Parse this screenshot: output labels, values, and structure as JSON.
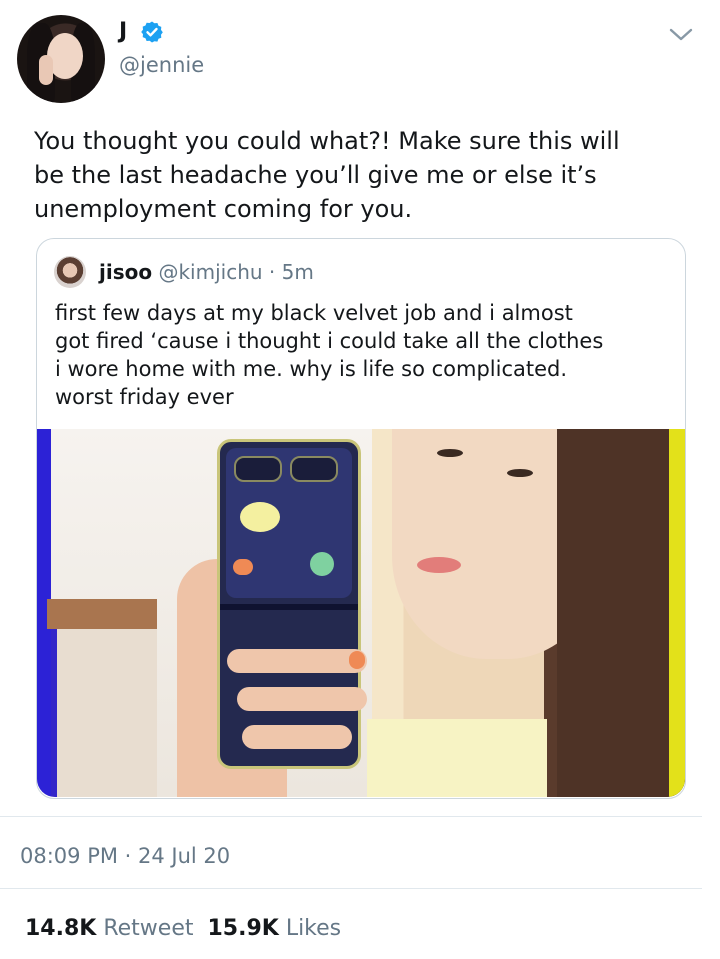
{
  "tweet": {
    "author": {
      "display_name": "J",
      "handle": "@jennie",
      "verified": true
    },
    "text_lines": [
      "You thought you could what?! Make sure this will",
      "be the last headache you’ll give me or else it’s",
      "unemployment coming for you."
    ],
    "timestamp": "08:09 PM · 24 Jul 20",
    "retweets": {
      "count": "14.8K",
      "label": "Retweet"
    },
    "likes": {
      "count": "15.9K",
      "label": "Likes"
    }
  },
  "quoted_tweet": {
    "display_name": "jisoo",
    "handle": "@kimjichu",
    "time": "· 5m",
    "text_lines": [
      "first few days at my black velvet job and i almost",
      "got fired ‘cause i thought i could take all the clothes",
      "i wore home with me. why is life so complicated.",
      "worst friday ever"
    ]
  },
  "colors": {
    "verified_blue": "#1da1f2",
    "muted_text": "#657786",
    "primary_text": "#14171a",
    "border": "#ccd6dd"
  },
  "icons": {
    "verified": "verified-badge-icon",
    "more": "chevron-down-icon"
  }
}
